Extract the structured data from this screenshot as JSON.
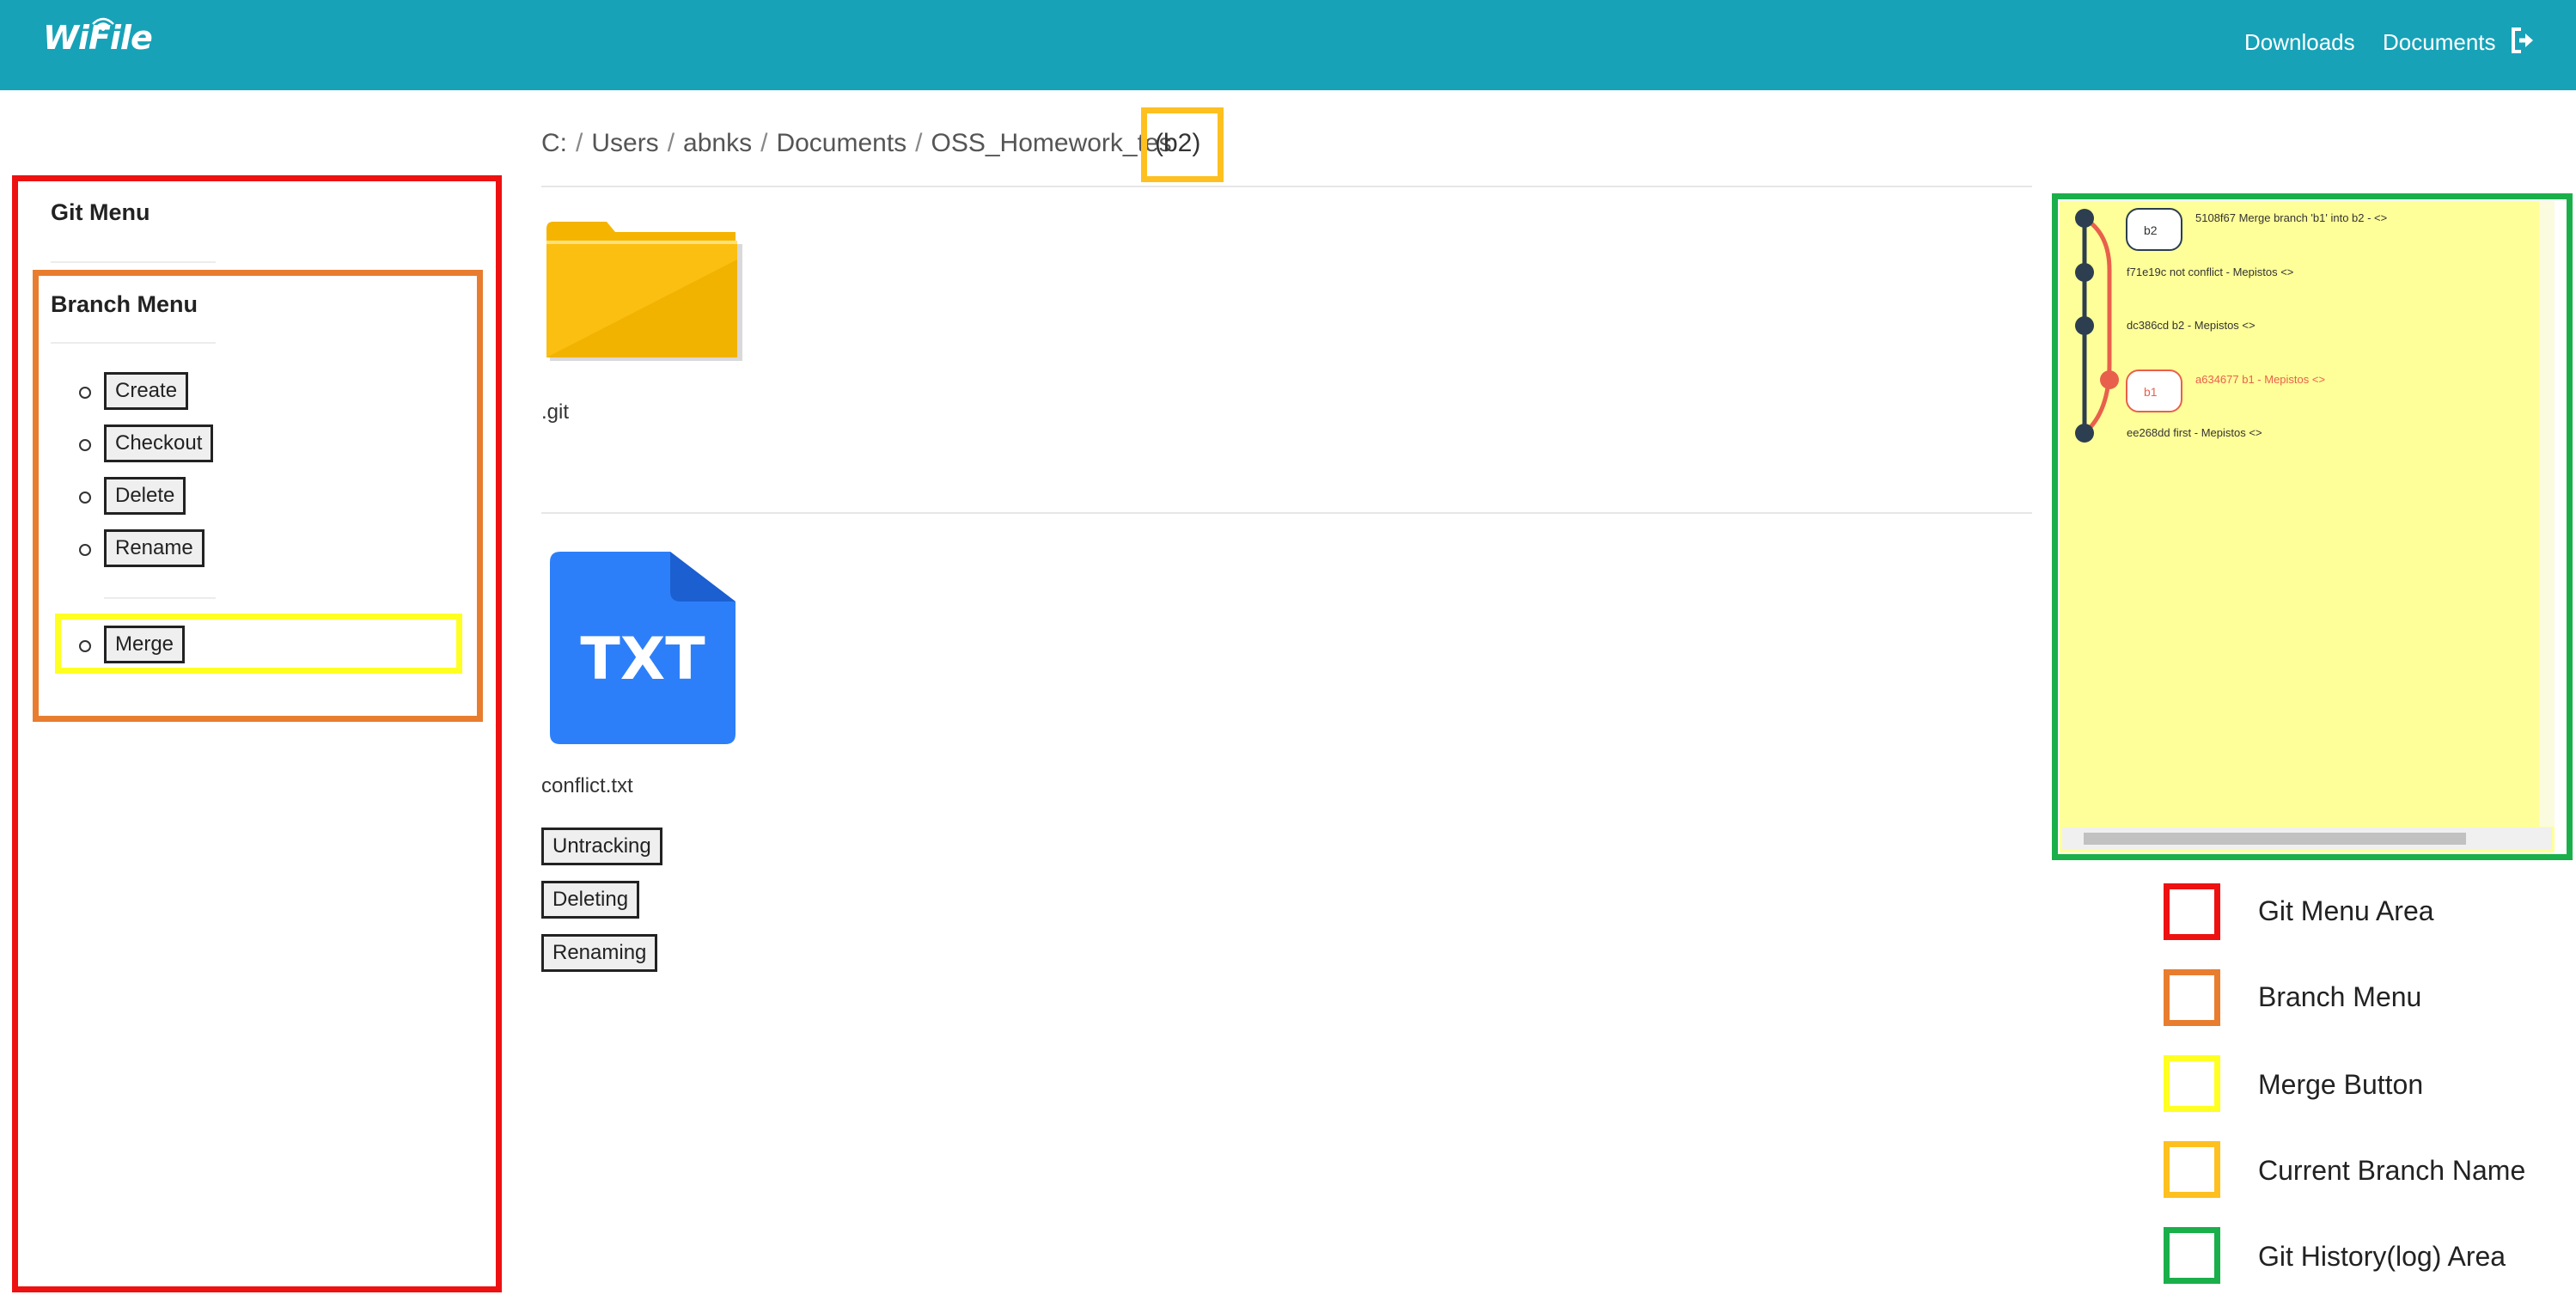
{
  "navbar": {
    "brand": "WiFile",
    "links": [
      "Downloads",
      "Documents"
    ],
    "logout_icon": "sign-out-icon"
  },
  "breadcrumb": {
    "items": [
      "C:",
      "Users",
      "abnks",
      "Documents",
      "OSS_Homework_tes"
    ],
    "current_branch": "(b2)"
  },
  "git_menu": {
    "title": "Git Menu",
    "branch_menu": {
      "title": "Branch Menu",
      "buttons": [
        "Create",
        "Checkout",
        "Delete",
        "Rename"
      ],
      "merge_button": "Merge"
    }
  },
  "files": [
    {
      "name": ".git",
      "icon": "folder-icon"
    },
    {
      "name": "conflict.txt",
      "icon": "txt-file-icon",
      "icon_text": "TXT",
      "actions": [
        "Untracking",
        "Deleting",
        "Renaming"
      ]
    }
  ],
  "git_log": {
    "commits": [
      {
        "branch_tag": "b2",
        "text": "5108f67 Merge branch 'b1' into b2 - <>"
      },
      {
        "branch_tag": "",
        "text": "f71e19c not conflict - Mepistos <>"
      },
      {
        "branch_tag": "",
        "text": "dc386cd b2 - Mepistos <>"
      },
      {
        "branch_tag": "b1",
        "text": "a634677 b1 - Mepistos <>"
      },
      {
        "branch_tag": "",
        "text": "ee268dd first - Mepistos <>"
      }
    ],
    "colors": {
      "main": "#2c3e50",
      "branch": "#e8604c",
      "background": "#ffff99"
    }
  },
  "legend": [
    {
      "label": "Git Menu Area",
      "color": "#ee1111"
    },
    {
      "label": "Branch Menu",
      "color": "#e87d2f"
    },
    {
      "label": "Merge Button",
      "color": "#ffff22"
    },
    {
      "label": "Current Branch Name",
      "color": "#fdc020"
    },
    {
      "label": "Git History(log) Area",
      "color": "#1aaf4a"
    }
  ]
}
